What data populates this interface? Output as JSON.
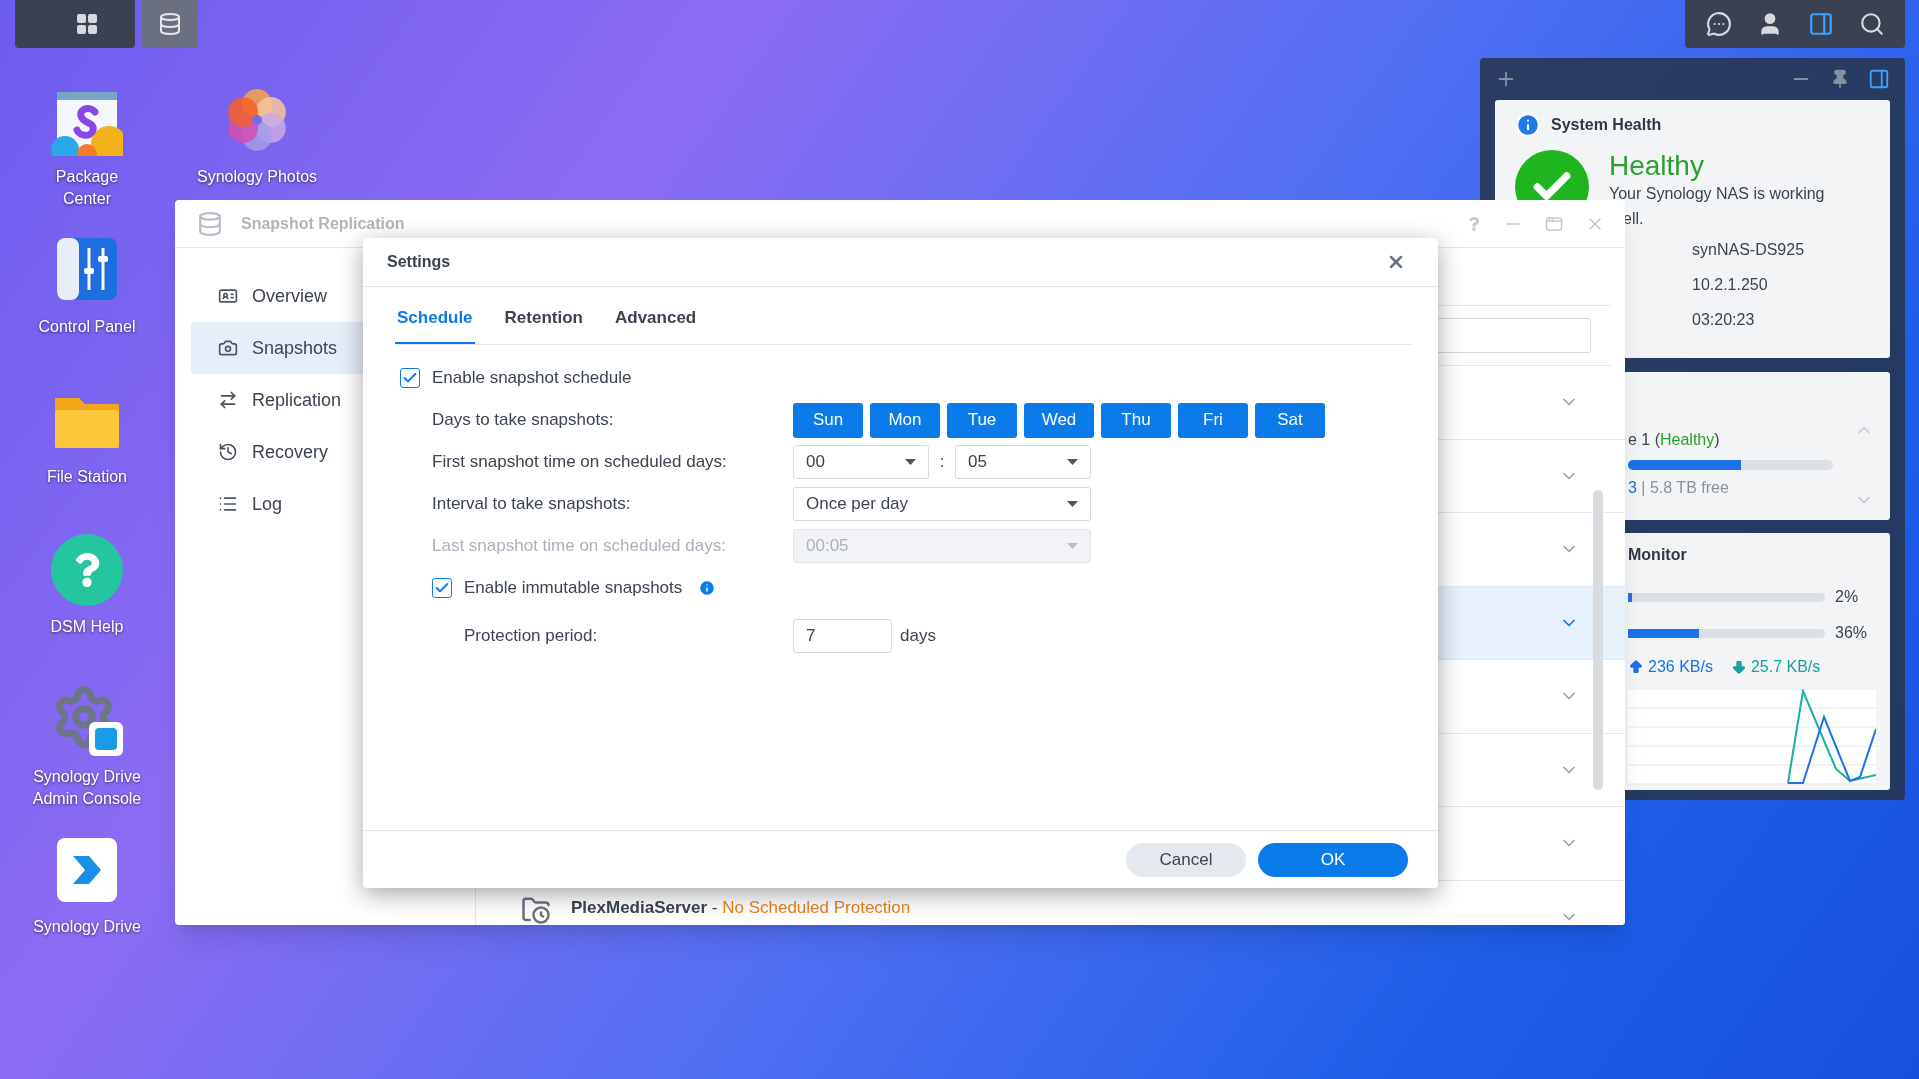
{
  "desktop_columns": [
    {
      "icons": [
        {
          "kind": "package",
          "label": "Package Center"
        },
        {
          "kind": "control",
          "label": "Control Panel"
        },
        {
          "kind": "files",
          "label": "File Station"
        },
        {
          "kind": "help",
          "label": "DSM Help"
        },
        {
          "kind": "drive_admin",
          "label": "Synology Drive Admin Console"
        },
        {
          "kind": "drive",
          "label": "Synology Drive"
        }
      ]
    },
    {
      "icons": [
        {
          "kind": "photos",
          "label": "Synology Photos"
        }
      ]
    }
  ],
  "widgets": {
    "system_health": {
      "title": "System Health",
      "status": "Healthy",
      "message": "Your Synology NAS is working",
      "message_rest": "ell.",
      "values": [
        "synNAS-DS925",
        "10.2.1.250",
        "03:20:23"
      ]
    },
    "storage": {
      "volume_prefix": "e 1 (",
      "volume_status": "Healthy",
      "volume_suffix": ")",
      "level": 0.55,
      "usage_prefix": "3",
      "usage_rest": " | 5.8 TB free"
    },
    "monitor": {
      "title": "Monitor",
      "meters": [
        {
          "level": 0.02,
          "reading": "2%"
        },
        {
          "level": 0.36,
          "reading": "36%"
        }
      ],
      "upload": "236 KB/s",
      "download": "25.7 KB/s"
    }
  },
  "window": {
    "title": "Snapshot Replication",
    "sidebar": [
      {
        "kind": "overview",
        "label": "Overview",
        "selected": false
      },
      {
        "kind": "snapshots",
        "label": "Snapshots",
        "selected": true
      },
      {
        "kind": "replication",
        "label": "Replication",
        "selected": false
      },
      {
        "kind": "recovery",
        "label": "Recovery",
        "selected": false
      },
      {
        "kind": "log",
        "label": "Log",
        "selected": false
      }
    ],
    "rows": [
      {
        "selected": false
      },
      {
        "selected": false
      },
      {
        "selected": false
      },
      {
        "selected": true
      },
      {
        "selected": false
      },
      {
        "selected": false
      },
      {
        "selected": false
      },
      {
        "selected": false,
        "name": "PlexMediaServer",
        "separator": " - ",
        "status": "No Scheduled Protection"
      }
    ]
  },
  "dialog": {
    "title": "Settings",
    "tabs": [
      {
        "label": "Schedule",
        "selected": true
      },
      {
        "label": "Retention",
        "selected": false
      },
      {
        "label": "Advanced",
        "selected": false
      }
    ],
    "form": [
      {
        "kind": "checkbox",
        "label": "Enable snapshot schedule",
        "checked": true,
        "children": [
          {
            "kind": "days",
            "label": "Days to take snapshots:",
            "days": [
              {
                "label": "Sun",
                "selected": true
              },
              {
                "label": "Mon",
                "selected": true
              },
              {
                "label": "Tue",
                "selected": true
              },
              {
                "label": "Wed",
                "selected": true
              },
              {
                "label": "Thu",
                "selected": true
              },
              {
                "label": "Fri",
                "selected": true
              },
              {
                "label": "Sat",
                "selected": true
              }
            ]
          },
          {
            "kind": "time",
            "label": "First snapshot time on scheduled days:",
            "hour": "00",
            "separator": ":",
            "minute": "05"
          },
          {
            "kind": "select",
            "label": "Interval to take snapshots:",
            "value": "Once per day",
            "disabled": false
          },
          {
            "kind": "select",
            "label": "Last snapshot time on scheduled days:",
            "value": "00:05",
            "disabled": true
          },
          {
            "kind": "checkbox",
            "label": "Enable immutable snapshots",
            "checked": true,
            "info": true,
            "children": [
              {
                "kind": "number",
                "label": "Protection period:",
                "value": "7",
                "unit": "days"
              }
            ]
          }
        ]
      }
    ],
    "buttons": [
      {
        "kind": "secondary",
        "label": "Cancel"
      },
      {
        "kind": "primary",
        "label": "OK"
      }
    ]
  }
}
